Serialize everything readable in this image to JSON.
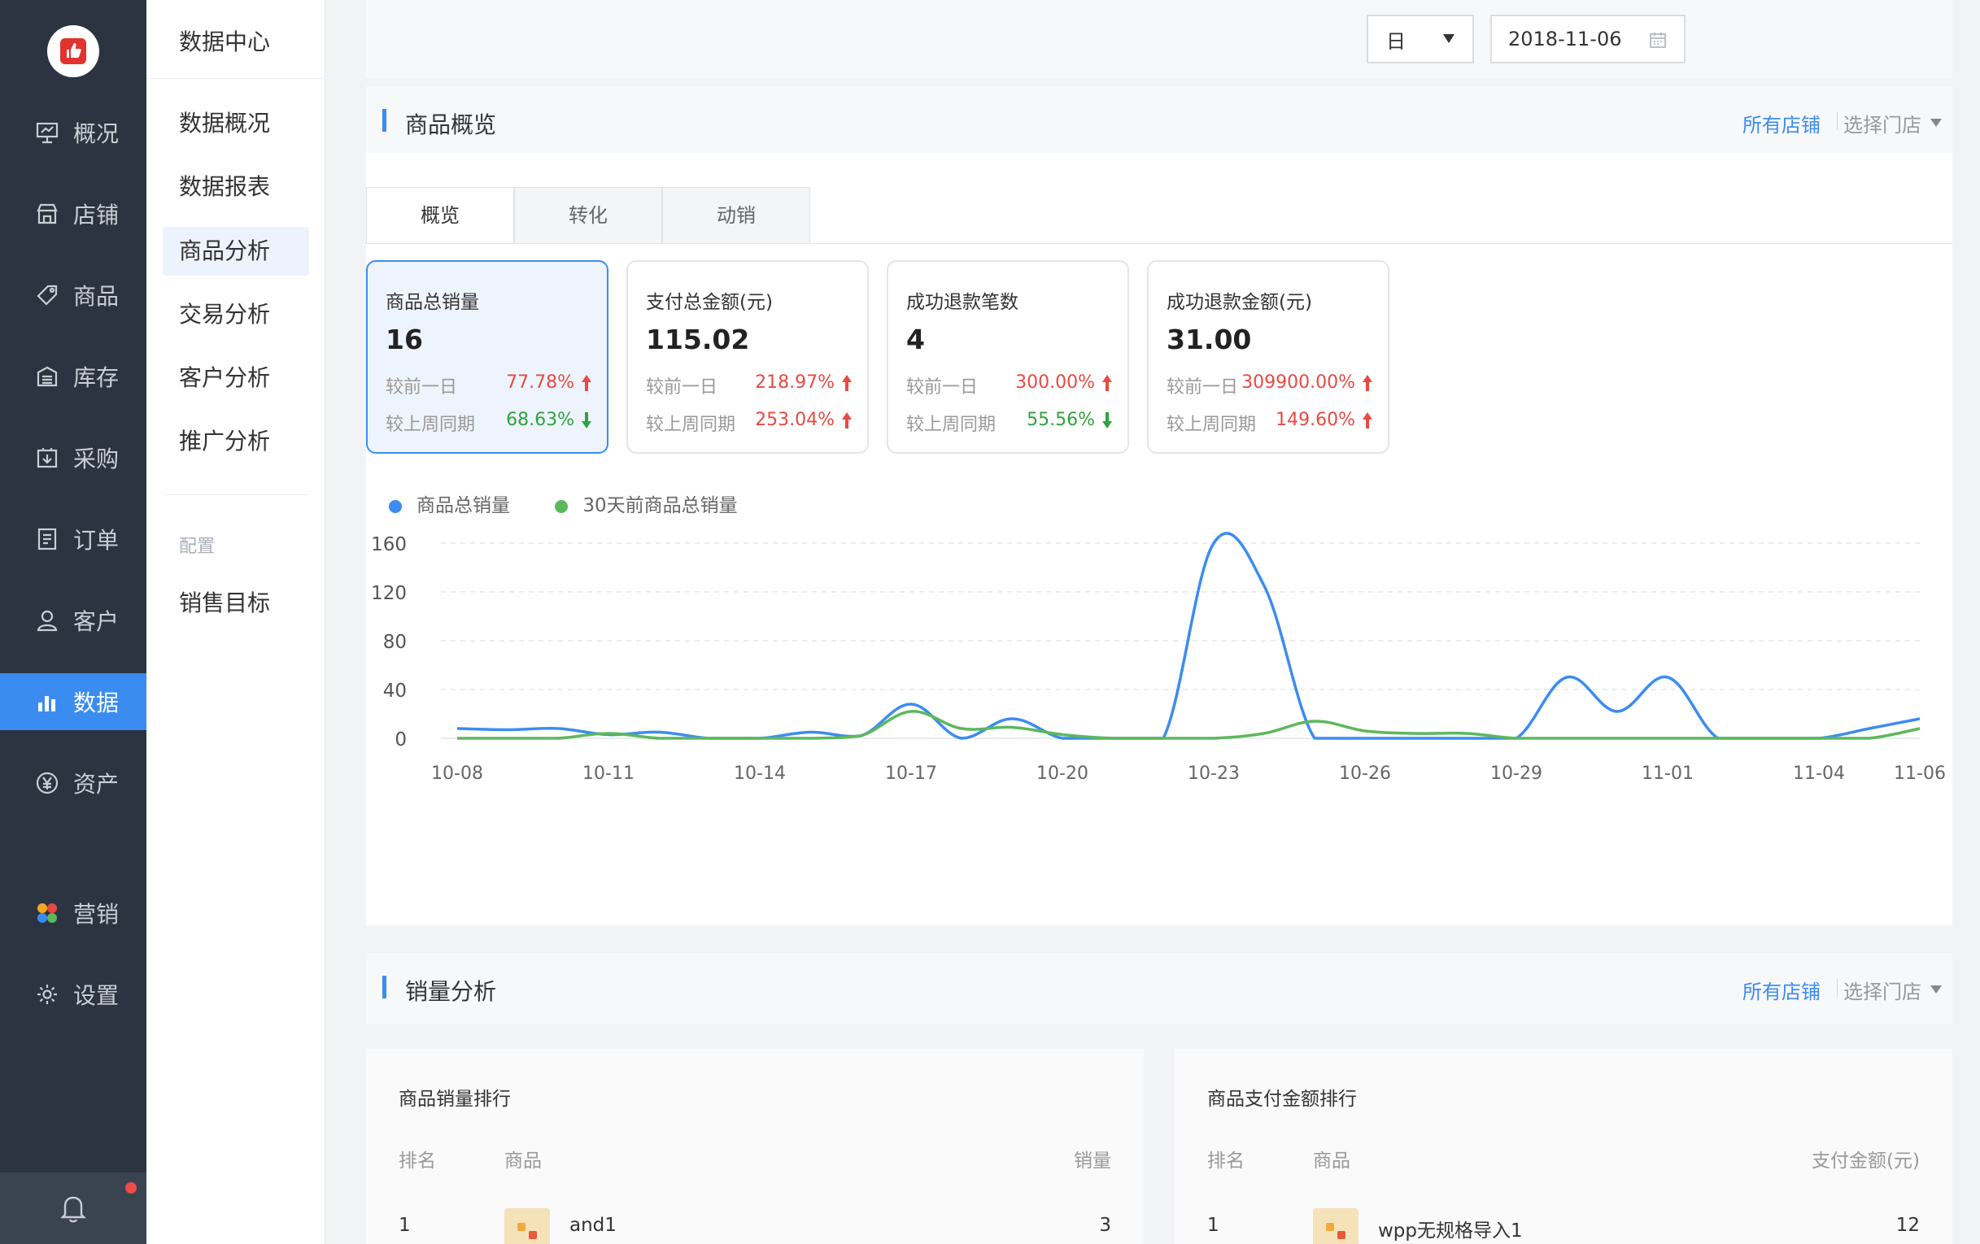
{
  "rail": {
    "items": [
      {
        "label": "概况",
        "icon": "presentation-icon"
      },
      {
        "label": "店铺",
        "icon": "store-icon"
      },
      {
        "label": "商品",
        "icon": "tag-icon"
      },
      {
        "label": "库存",
        "icon": "warehouse-icon"
      },
      {
        "label": "采购",
        "icon": "purchase-icon"
      },
      {
        "label": "订单",
        "icon": "order-icon"
      },
      {
        "label": "客户",
        "icon": "user-icon"
      },
      {
        "label": "数据",
        "icon": "bar-chart-icon"
      },
      {
        "label": "资产",
        "icon": "yen-icon"
      },
      {
        "label": "营销",
        "icon": "marketing-icon"
      },
      {
        "label": "设置",
        "icon": "gear-icon"
      }
    ],
    "active_index": 7,
    "accent": "#3b8cf0"
  },
  "subnav": {
    "title": "数据中心",
    "items": [
      "数据概况",
      "数据报表",
      "商品分析",
      "交易分析",
      "客户分析",
      "推广分析"
    ],
    "active_index": 2,
    "config_label": "配置",
    "config_items": [
      "销售目标"
    ]
  },
  "filter": {
    "period": "日",
    "date": "2018-11-06"
  },
  "overview": {
    "title": "商品概览",
    "all_stores": "所有店铺",
    "pick_store": "选择门店",
    "tabs": [
      "概览",
      "转化",
      "动销"
    ],
    "cards": [
      {
        "title": "商品总销量",
        "value": "16",
        "day_label": "较前一日",
        "day_pct": "77.78%",
        "day_dir": "up",
        "week_label": "较上周同期",
        "week_pct": "68.63%",
        "week_dir": "down"
      },
      {
        "title": "支付总金额(元)",
        "value": "115.02",
        "day_label": "较前一日",
        "day_pct": "218.97%",
        "day_dir": "up",
        "week_label": "较上周同期",
        "week_pct": "253.04%",
        "week_dir": "up"
      },
      {
        "title": "成功退款笔数",
        "value": "4",
        "day_label": "较前一日",
        "day_pct": "300.00%",
        "day_dir": "up",
        "week_label": "较上周同期",
        "week_pct": "55.56%",
        "week_dir": "down"
      },
      {
        "title": "成功退款金额(元)",
        "value": "31.00",
        "day_label": "较前一日",
        "day_pct": "309900.00%",
        "day_dir": "up",
        "week_label": "较上周同期",
        "week_pct": "149.60%",
        "week_dir": "up"
      }
    ]
  },
  "chart_data": {
    "type": "line",
    "x": [
      "10-08",
      "10-09",
      "10-10",
      "10-11",
      "10-12",
      "10-13",
      "10-14",
      "10-15",
      "10-16",
      "10-17",
      "10-18",
      "10-19",
      "10-20",
      "10-21",
      "10-22",
      "10-23",
      "10-24",
      "10-25",
      "10-26",
      "10-27",
      "10-28",
      "10-29",
      "10-30",
      "10-31",
      "11-01",
      "11-02",
      "11-03",
      "11-04",
      "11-05",
      "11-06"
    ],
    "x_ticks": [
      "10-08",
      "10-11",
      "10-14",
      "10-17",
      "10-20",
      "10-23",
      "10-26",
      "10-29",
      "11-01",
      "11-04",
      "11-06"
    ],
    "series": [
      {
        "name": "商品总销量",
        "color": "#3b8cf0",
        "values": [
          8,
          7,
          8,
          3,
          5,
          0,
          0,
          5,
          2,
          28,
          0,
          16,
          0,
          0,
          0,
          160,
          125,
          0,
          0,
          0,
          0,
          0,
          50,
          22,
          50,
          0,
          0,
          0,
          8,
          16
        ]
      },
      {
        "name": "30天前商品总销量",
        "color": "#5cb85c",
        "values": [
          0,
          0,
          0,
          4,
          0,
          0,
          0,
          0,
          2,
          22,
          8,
          9,
          3,
          0,
          0,
          0,
          4,
          14,
          6,
          4,
          4,
          0,
          0,
          0,
          0,
          0,
          0,
          0,
          0,
          8
        ]
      }
    ],
    "ylim": [
      0,
      160
    ],
    "y_ticks": [
      0,
      40,
      80,
      120,
      160
    ],
    "grid": true,
    "legend": "top-left"
  },
  "sales": {
    "title": "销量分析",
    "all_stores": "所有店铺",
    "pick_store": "选择门店",
    "left": {
      "title": "商品销量排行",
      "col_rank": "排名",
      "col_product": "商品",
      "col_value": "销量",
      "rows": [
        {
          "rank": "1",
          "product": "and1",
          "value": "3"
        }
      ]
    },
    "right": {
      "title": "商品支付金额排行",
      "col_rank": "排名",
      "col_product": "商品",
      "col_value": "支付金额(元)",
      "rows": [
        {
          "rank": "1",
          "product": "wpp无规格导入1",
          "value": "12"
        }
      ]
    }
  }
}
